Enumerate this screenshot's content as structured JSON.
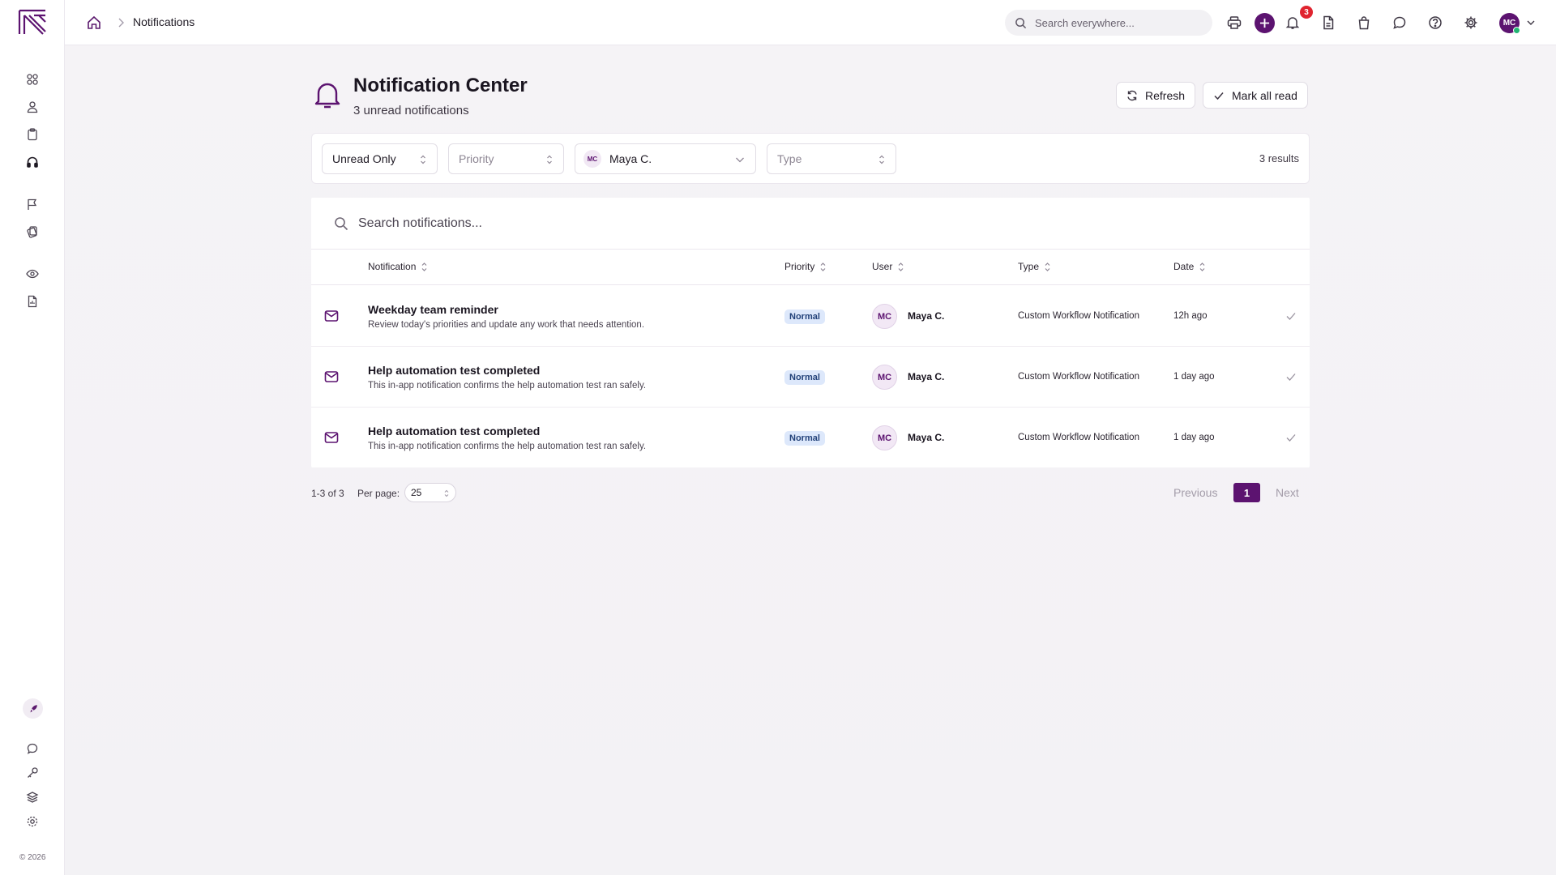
{
  "breadcrumb": {
    "current": "Notifications"
  },
  "topbar": {
    "search_placeholder": "Search everywhere...",
    "notification_count": "3",
    "user_initials": "MC"
  },
  "header": {
    "title": "Notification Center",
    "subtitle": "3 unread notifications",
    "refresh_label": "Refresh",
    "mark_all_read_label": "Mark all read"
  },
  "filters": {
    "status": "Unread Only",
    "priority_placeholder": "Priority",
    "user_initials": "MC",
    "user": "Maya C.",
    "type_placeholder": "Type",
    "results": "3 results"
  },
  "table": {
    "search_placeholder": "Search notifications...",
    "columns": [
      "Notification",
      "Priority",
      "User",
      "Type",
      "Date"
    ],
    "rows": [
      {
        "title": "Weekday team reminder",
        "description": "Review today's priorities and update any work that needs attention.",
        "priority": "Normal",
        "user_initials": "MC",
        "user": "Maya C.",
        "type": "Custom Workflow Notification",
        "date": "12h ago"
      },
      {
        "title": "Help automation test completed",
        "description": "This in-app notification confirms the help automation test ran safely.",
        "priority": "Normal",
        "user_initials": "MC",
        "user": "Maya C.",
        "type": "Custom Workflow Notification",
        "date": "1 day ago"
      },
      {
        "title": "Help automation test completed",
        "description": "This in-app notification confirms the help automation test ran safely.",
        "priority": "Normal",
        "user_initials": "MC",
        "user": "Maya C.",
        "type": "Custom Workflow Notification",
        "date": "1 day ago"
      }
    ]
  },
  "pagination": {
    "range": "1-3 of 3",
    "per_page_label": "Per page:",
    "per_page_value": "25",
    "previous": "Previous",
    "current_page": "1",
    "next": "Next"
  },
  "footer": {
    "copyright": "© 2026"
  },
  "colors": {
    "brand": "#5c1370",
    "badge_red": "#e0242f",
    "priority_bg": "#dde8fb"
  },
  "icons": {
    "sidebar": [
      "grid-icon",
      "user-icon",
      "clipboard-icon",
      "headset-icon",
      "flag-icon",
      "tags-icon",
      "eye-icon",
      "report-icon",
      "rocket-icon",
      "chat-icon",
      "key-icon",
      "layers-icon",
      "gear-icon"
    ],
    "topbar": [
      "search-icon",
      "printer-icon",
      "plus-icon",
      "bell-icon",
      "document-icon",
      "bag-icon",
      "chat-icon",
      "help-icon",
      "gear-icon"
    ]
  }
}
